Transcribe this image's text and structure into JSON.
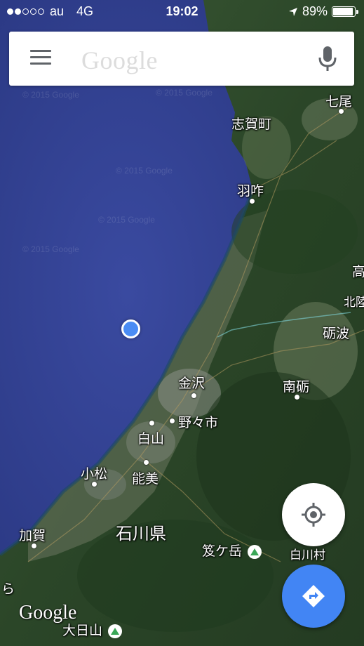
{
  "status_bar": {
    "carrier": "au",
    "network": "4G",
    "time": "19:02",
    "battery": "89%",
    "signal_bars_filled": 2,
    "signal_bars_total": 5
  },
  "search": {
    "placeholder": "Google"
  },
  "map": {
    "labels": {
      "nanao": "七尾",
      "shikamachi": "志賀町",
      "hakui": "羽咋",
      "taka": "高",
      "hokuriku": "北陸",
      "tonami": "砺波",
      "kanazawa": "金沢",
      "nanto": "南砺",
      "nonoichi": "野々市",
      "hakusan": "白山",
      "komatsu": "小松",
      "nomi": "能美",
      "kaga": "加賀",
      "ishikawa_pref": "石川県",
      "kasagatake": "笈ケ岳",
      "shirakawa": "白川村",
      "ra": "ら",
      "dainichisan": "大日山"
    },
    "watermark": "© 2015 Google",
    "google_logo": "Google"
  },
  "colors": {
    "sea": "#2f3f90",
    "land": "#2c4a2a",
    "accent": "#4285f4",
    "mountain_icon": "#3aa757"
  },
  "icons": {
    "menu": "hamburger-menu-icon",
    "mic": "microphone-icon",
    "location": "crosshair-icon",
    "directions": "directions-arrow-icon"
  }
}
